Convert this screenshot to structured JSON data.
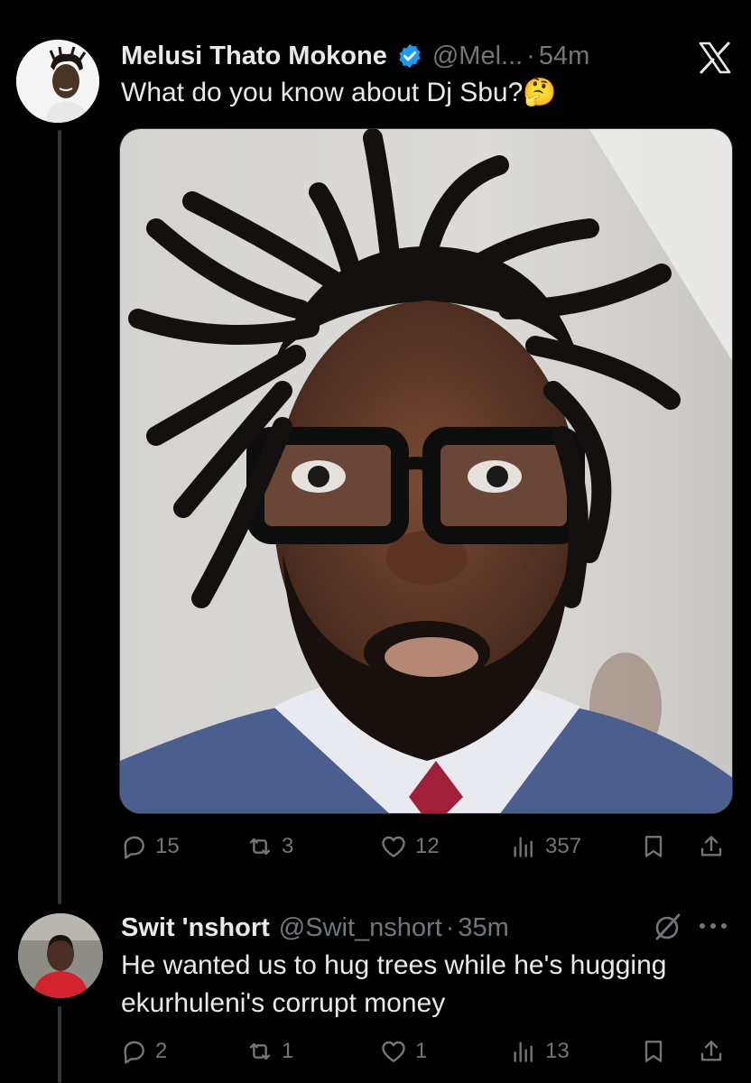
{
  "tweet": {
    "author": "Melusi Thato Mokone",
    "handle": "@Mel...",
    "separator": "·",
    "time": "54m",
    "text": "What do you know about Dj Sbu?",
    "emoji": "🤔",
    "stats": {
      "replies": "15",
      "reposts": "3",
      "likes": "12",
      "views": "357"
    }
  },
  "reply": {
    "author": "Swit 'nshort",
    "handle": "@Swit_nshort",
    "separator": "·",
    "time": "35m",
    "text": "He wanted us to hug trees while he's hugging ekurhuleni's corrupt money",
    "stats": {
      "replies": "2",
      "reposts": "1",
      "likes": "1",
      "views": "13"
    }
  },
  "colors": {
    "background": "#000000",
    "text": "#e7e9ea",
    "muted": "#71767b",
    "verified": "#1d9bf0",
    "thread_line": "#333639"
  },
  "icons": [
    "verified-badge-icon",
    "x-logo-icon",
    "grok-icon",
    "more-icon",
    "reply-icon",
    "repost-icon",
    "like-icon",
    "views-icon",
    "bookmark-icon",
    "share-icon"
  ]
}
